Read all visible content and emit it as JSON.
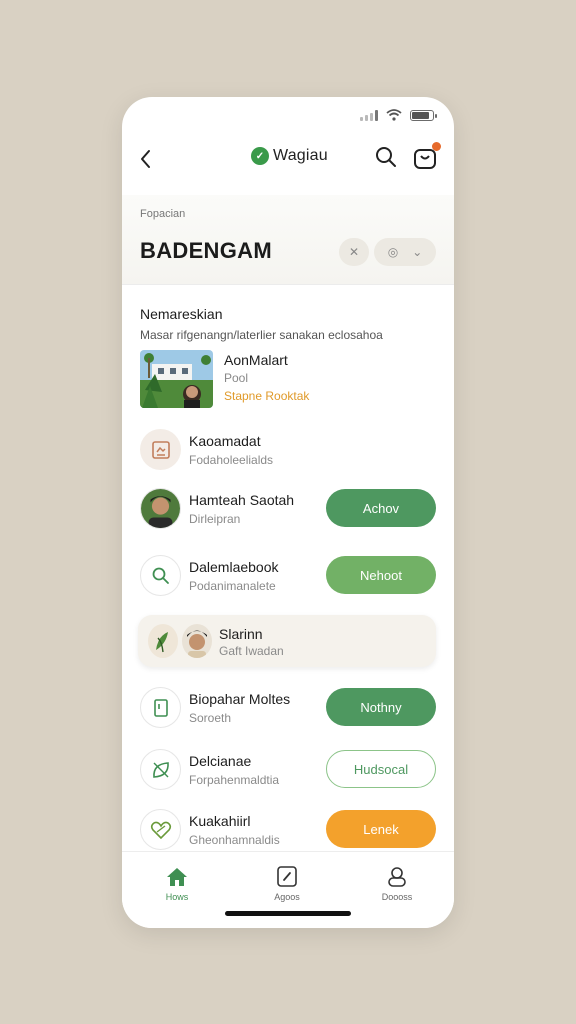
{
  "app": {
    "name": "Wagiau",
    "logo_glyph": "✓"
  },
  "hero": {
    "small_label": "Fopacian",
    "title": "BADENGAM",
    "chip1": "✕",
    "chip2_a": "◎",
    "chip2_b": "⌄"
  },
  "section": {
    "title": "Nemareskian",
    "subtitle": "Masar rifgenangn/laterlier sanakan eclosahoa"
  },
  "feature": {
    "title": "AonMalart",
    "meta": "Pool",
    "link": "Stapne Rooktak"
  },
  "rows": [
    {
      "title": "Kaoamadat",
      "subtitle": "Fodaholeelialds",
      "icon": "document-icon"
    },
    {
      "title": "Hamteah Saotah",
      "subtitle": "Dirleipran",
      "icon": "avatar",
      "action": "Achov"
    },
    {
      "title": "Dalemlaebook",
      "subtitle": "Podanimanalete",
      "icon": "search-icon",
      "action": "Nehoot"
    },
    {
      "title": "Biopahar Moltes",
      "subtitle": "Soroeth",
      "icon": "bookmark-icon",
      "action": "Nothny"
    },
    {
      "title": "Delcianae",
      "subtitle": "Forpahenmaldtia",
      "icon": "leaf-icon",
      "action": "Hudsocal"
    },
    {
      "title": "Kuakahiirl",
      "subtitle": "Gheonhamnaldis",
      "icon": "heart-icon",
      "action": "Lenek"
    }
  ],
  "highlight": {
    "title": "Slarinn",
    "subtitle": "Gaft Iwadan"
  },
  "tabs": [
    {
      "label": "Hows",
      "icon": "home-icon",
      "active": true
    },
    {
      "label": "Agoos",
      "icon": "compass-icon",
      "active": false
    },
    {
      "label": "Doooss",
      "icon": "profile-icon",
      "active": false
    }
  ],
  "colors": {
    "accent_green": "#4e9860",
    "light_green": "#72b166",
    "orange": "#f3a12c",
    "background": "#d9d1c3"
  }
}
